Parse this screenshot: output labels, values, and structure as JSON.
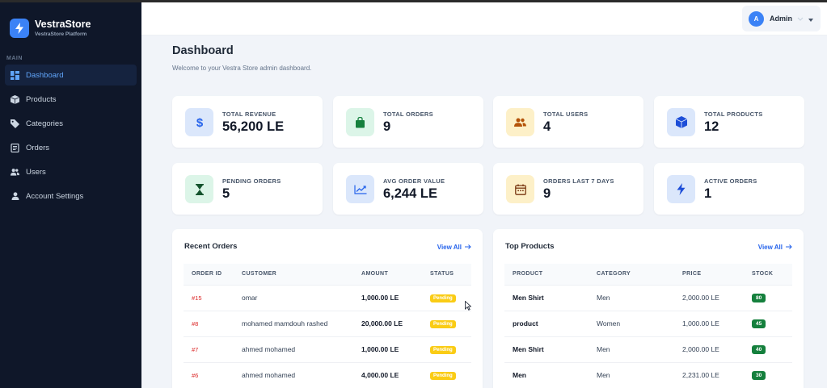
{
  "brand": {
    "name": "VestraStore",
    "subtitle": "VestraStore Platform"
  },
  "sidebar": {
    "section_label": "MAIN",
    "items": [
      {
        "label": "Dashboard",
        "icon": "dashboard-icon",
        "active": true
      },
      {
        "label": "Products",
        "icon": "box-icon"
      },
      {
        "label": "Categories",
        "icon": "tag-icon"
      },
      {
        "label": "Orders",
        "icon": "clipboard-icon"
      },
      {
        "label": "Users",
        "icon": "users-icon"
      },
      {
        "label": "Account Settings",
        "icon": "user-icon"
      }
    ]
  },
  "topbar": {
    "avatar_initial": "A",
    "user_name": "Admin"
  },
  "page": {
    "title": "Dashboard",
    "subtitle": "Welcome to your Vestra Store admin dashboard."
  },
  "stats": [
    {
      "label": "TOTAL REVENUE",
      "value": "56,200 LE",
      "icon": "dollar-icon",
      "color": "#dbe7fb"
    },
    {
      "label": "TOTAL ORDERS",
      "value": "9",
      "icon": "shopping-bag-icon",
      "color": "#dcf5e8"
    },
    {
      "label": "TOTAL USERS",
      "value": "4",
      "icon": "users-icon",
      "color": "#fdf0c8"
    },
    {
      "label": "TOTAL PRODUCTS",
      "value": "12",
      "icon": "cube-icon",
      "color": "#dbe7fb"
    },
    {
      "label": "PENDING ORDERS",
      "value": "5",
      "icon": "hourglass-icon",
      "color": "#dcf5e8"
    },
    {
      "label": "AVG ORDER VALUE",
      "value": "6,244 LE",
      "icon": "trend-icon",
      "color": "#dbe7fb"
    },
    {
      "label": "ORDERS LAST 7 DAYS",
      "value": "9",
      "icon": "calendar-icon",
      "color": "#fdf0c8"
    },
    {
      "label": "ACTIVE ORDERS",
      "value": "1",
      "icon": "bolt-icon",
      "color": "#dbe7fb"
    }
  ],
  "recent_orders": {
    "title": "Recent Orders",
    "view_all": "View All",
    "columns": [
      "ORDER ID",
      "CUSTOMER",
      "AMOUNT",
      "STATUS"
    ],
    "rows": [
      {
        "id": "#15",
        "customer": "omar",
        "amount": "1,000.00 LE",
        "status": "Pending"
      },
      {
        "id": "#8",
        "customer": "mohamed mamdouh rashed",
        "amount": "20,000.00 LE",
        "status": "Pending"
      },
      {
        "id": "#7",
        "customer": "ahmed mohamed",
        "amount": "1,000.00 LE",
        "status": "Pending"
      },
      {
        "id": "#6",
        "customer": "ahmed mohamed",
        "amount": "4,000.00 LE",
        "status": "Pending"
      }
    ]
  },
  "top_products": {
    "title": "Top Products",
    "view_all": "View All",
    "columns": [
      "PRODUCT",
      "CATEGORY",
      "PRICE",
      "STOCK"
    ],
    "rows": [
      {
        "product": "Men Shirt",
        "category": "Men",
        "price": "2,000.00 LE",
        "stock": "80"
      },
      {
        "product": "product",
        "category": "Women",
        "price": "1,000.00 LE",
        "stock": "45"
      },
      {
        "product": "Men Shirt",
        "category": "Men",
        "price": "2,000.00 LE",
        "stock": "40"
      },
      {
        "product": "Men",
        "category": "Men",
        "price": "2,231.00 LE",
        "stock": "30"
      }
    ]
  },
  "colors": {
    "sidebar_bg": "#0f1729",
    "accent": "#3b82f6",
    "pending_badge": "#facc15",
    "stock_badge": "#15803d",
    "order_id": "#dc2626"
  }
}
